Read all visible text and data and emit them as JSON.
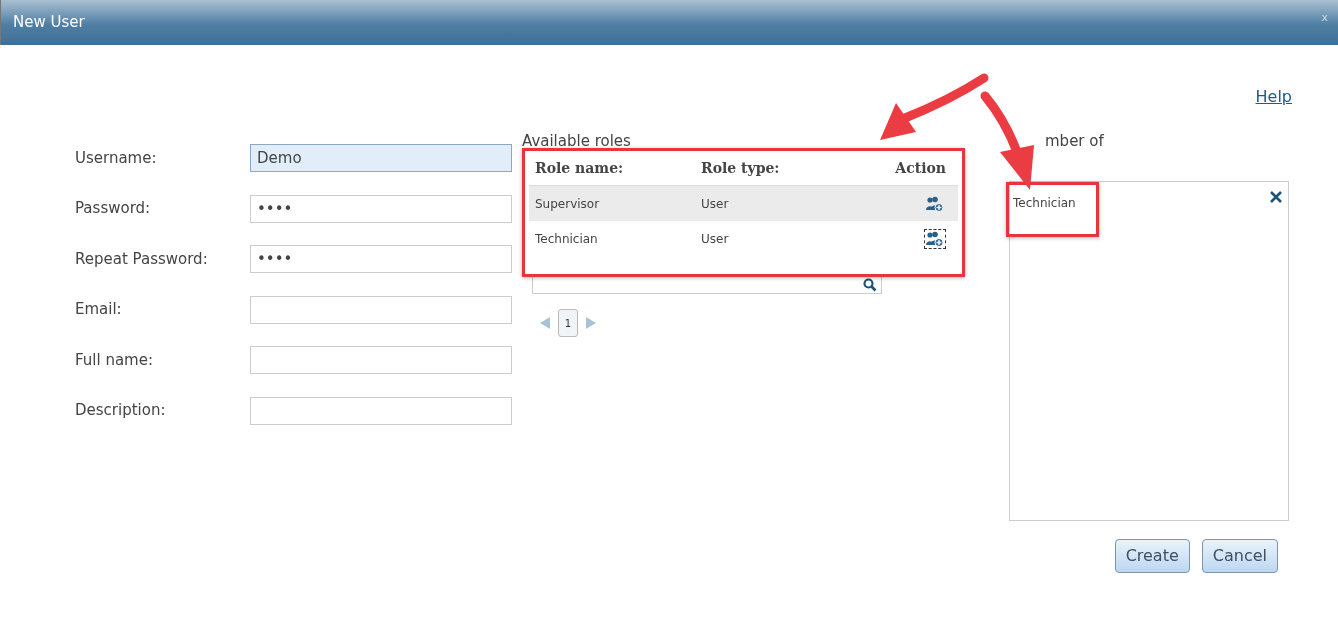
{
  "window": {
    "title": "New User",
    "close": "x"
  },
  "help_link": "Help",
  "form": [
    {
      "label": "Username:",
      "value": "Demo",
      "focused": true
    },
    {
      "label": "Password:",
      "value": "••••",
      "focused": false
    },
    {
      "label": "Repeat Password:",
      "value": "••••",
      "focused": false
    },
    {
      "label": "Email:",
      "focused": false
    },
    {
      "label": "Full name:",
      "focused": false
    },
    {
      "label": "Description:",
      "focused": false
    }
  ],
  "available_roles": {
    "title": "Available roles",
    "columns": [
      "Role name:",
      "Role type:",
      "Action"
    ],
    "rows": [
      {
        "name": "Supervisor",
        "type": "User",
        "selected": true,
        "focused": false
      },
      {
        "name": "Technician",
        "type": "User",
        "selected": false,
        "focused": true
      }
    ],
    "pagination": {
      "pages": [
        {
          "label": "1",
          "selected": true
        }
      ]
    }
  },
  "member_of": {
    "title": "mber of",
    "items": [
      "Technician"
    ]
  },
  "buttons": [
    "Create",
    "Cancel"
  ]
}
